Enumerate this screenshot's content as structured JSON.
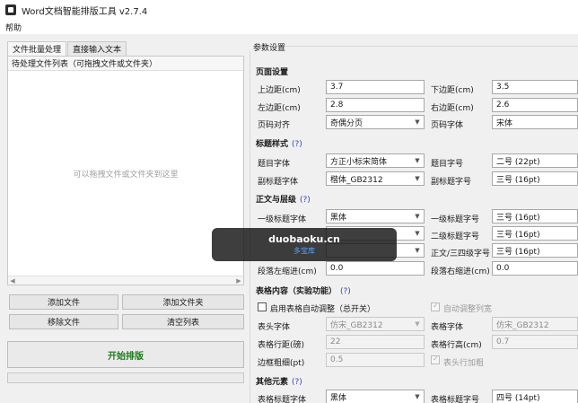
{
  "window": {
    "title": "Word文档智能排版工具 v2.7.4"
  },
  "menu": {
    "help": "帮助"
  },
  "tabs": [
    {
      "label": "文件批量处理"
    },
    {
      "label": "直接输入文本"
    }
  ],
  "file_list": {
    "header": "待处理文件列表（可拖拽文件或文件夹）",
    "placeholder": "可以拖拽文件或文件夹到这里"
  },
  "buttons": {
    "add_file": "添加文件",
    "add_folder": "添加文件夹",
    "remove_file": "移除文件",
    "clear_list": "清空列表",
    "start": "开始排版"
  },
  "params": {
    "title": "参数设置",
    "help_mark": "(?)",
    "page": {
      "title": "页面设置",
      "top_margin_label": "上边距(cm)",
      "top_margin": "3.7",
      "bottom_margin_label": "下边距(cm)",
      "bottom_margin": "3.5",
      "left_margin_label": "左边距(cm)",
      "left_margin": "2.8",
      "right_margin_label": "右边距(cm)",
      "right_margin": "2.6",
      "page_num_align_label": "页码对齐",
      "page_num_align": "奇偶分页",
      "page_num_font_label": "页码字体",
      "page_num_font": "宋体"
    },
    "title_style": {
      "title": "标题样式",
      "main_font_label": "题目字体",
      "main_font": "方正小标宋简体",
      "main_size_label": "题目字号",
      "main_size": "二号 (22pt)",
      "sub_font_label": "副标题字体",
      "sub_font": "楷体_GB2312",
      "sub_size_label": "副标题字号",
      "sub_size": "三号 (16pt)"
    },
    "body": {
      "title": "正文与层级",
      "h1_font_label": "一级标题字体",
      "h1_font": "黑体",
      "h1_size_label": "一级标题字号",
      "h1_size": "三号 (16pt)",
      "h2_size_label": "二级标题字号",
      "h2_size": "三号 (16pt)",
      "body_size_label": "正文/三四级字号",
      "body_size": "三号 (16pt)",
      "para_left_label": "段落左缩进(cm)",
      "para_left": "0.0",
      "para_right_label": "段落右缩进(cm)",
      "para_right": "0.0"
    },
    "table": {
      "title": "表格内容（实验功能）",
      "auto_adjust_label": "启用表格自动调整（总开关）",
      "auto_width_label": "自动调整列宽",
      "header_font_label": "表头字体",
      "header_font": "仿宋_GB2312",
      "cell_font_label": "表格字体",
      "cell_font": "仿宋_GB2312",
      "line_spacing_label": "表格行距(磅)",
      "line_spacing": "22",
      "row_height_label": "表格行高(cm)",
      "row_height": "0.7",
      "border_label": "边框粗细(pt)",
      "border": "0.5",
      "header_bold_label": "表头行加粗"
    },
    "other": {
      "title": "其他元素",
      "table_title_font_label": "表格标题字体",
      "table_title_font": "黑体",
      "table_title_size_label": "表格标题字号",
      "table_title_size": "四号 (14pt)"
    }
  },
  "watermark": {
    "main": "duobaoku.cn",
    "sub": "多宝库"
  },
  "colors": {
    "start_text": "#1e7a1e",
    "help_link": "#3344cc"
  }
}
